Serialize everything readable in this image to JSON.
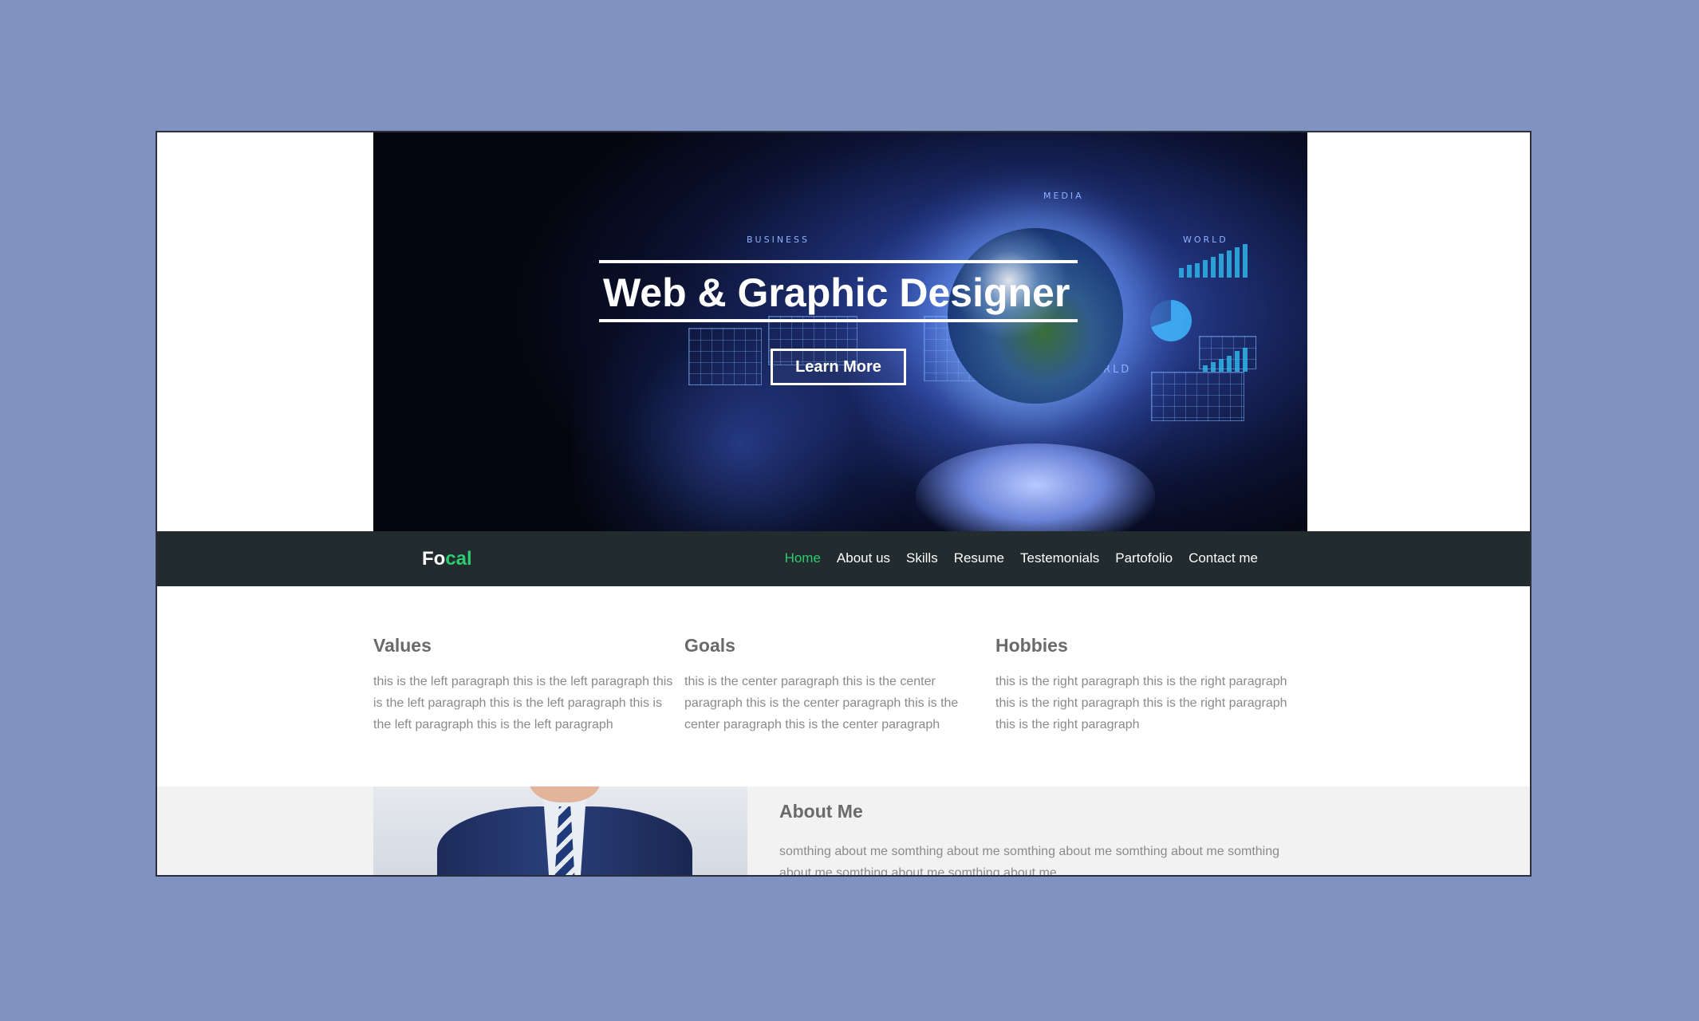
{
  "hero": {
    "title": "Web & Graphic Designer",
    "button_label": "Learn More",
    "labels": [
      "BUSINESS",
      "MEDIA",
      "WORLD",
      "RLD"
    ]
  },
  "nav": {
    "logo_part1": "Fo",
    "logo_part2": "cal",
    "items": [
      {
        "label": "Home",
        "active": true
      },
      {
        "label": "About us",
        "active": false
      },
      {
        "label": "Skills",
        "active": false
      },
      {
        "label": "Resume",
        "active": false
      },
      {
        "label": "Testemonials",
        "active": false
      },
      {
        "label": "Partofolio",
        "active": false
      },
      {
        "label": "Contact me",
        "active": false
      }
    ]
  },
  "columns": [
    {
      "title": "Values",
      "text": "this is the left paragraph this is the left paragraph this is the left paragraph this is the left paragraph this is the left paragraph this is the left paragraph"
    },
    {
      "title": "Goals",
      "text": "this is the center paragraph this is the center paragraph this is the center paragraph this is the center paragraph this is the center paragraph"
    },
    {
      "title": "Hobbies",
      "text": "this is the right paragraph this is the right paragraph this is the right paragraph this is the right paragraph this is the right paragraph"
    }
  ],
  "about": {
    "title": "About Me",
    "text": "somthing about me somthing about me somthing about me somthing about me somthing about me somthing about me somthing about me"
  },
  "colors": {
    "page_background": "#7f92c1",
    "navbar": "#222b2d",
    "accent_green": "#2ecc71",
    "heading_gray": "#6a6a6a",
    "body_gray": "#8a8a8a",
    "about_background": "#f2f2f2"
  }
}
